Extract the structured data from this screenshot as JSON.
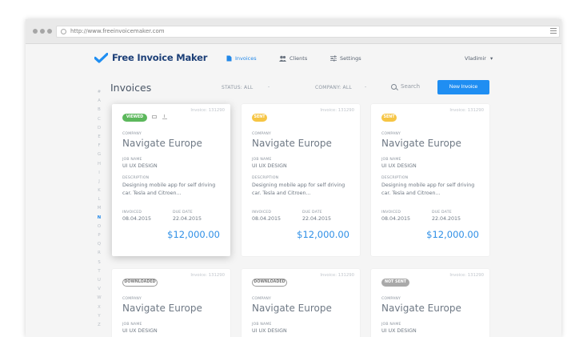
{
  "browser": {
    "url": "http://www.freeinvoicemaker.com"
  },
  "app": {
    "name": "Free Invoice Maker",
    "accent": "#1f8ef2",
    "logo_color": "#1c3f77"
  },
  "nav": {
    "items": [
      {
        "label": "Invoices",
        "icon": "document-icon",
        "active": true
      },
      {
        "label": "Clients",
        "icon": "users-icon",
        "active": false
      },
      {
        "label": "Settings",
        "icon": "sliders-icon",
        "active": false
      }
    ],
    "user": "Vladimir"
  },
  "toolbar": {
    "title": "Invoices",
    "status_filter": "STATUS: ALL",
    "company_filter": "COMPANY: ALL",
    "search_placeholder": "Search",
    "new_button": "New Invoice"
  },
  "alphabet": [
    "#",
    "A",
    "B",
    "C",
    "D",
    "E",
    "F",
    "G",
    "H",
    "I",
    "J",
    "K",
    "L",
    "M",
    "N",
    "O",
    "P",
    "Q",
    "R",
    "S",
    "T",
    "U",
    "V",
    "W",
    "X",
    "Y",
    "Z"
  ],
  "alphabet_active": "N",
  "labels": {
    "company": "COMPANY",
    "job_name": "JOB NAME",
    "description": "DESCRIPTION",
    "invoiced": "INVOICED",
    "due_date": "DUE DATE"
  },
  "cards": [
    {
      "status": "VIEWED",
      "invoice": "Invoice: 131290",
      "company": "Navigate Europe",
      "job": "UI UX DESIGN",
      "description": "Designing mobile app for self driving car. Tesla and Citroen...",
      "invoiced": "08.04.2015",
      "due": "22.04.2015",
      "amount": "$12,000.00"
    },
    {
      "status": "SENT",
      "invoice": "Invoice: 131290",
      "company": "Navigate Europe",
      "job": "UI UX DESIGN",
      "description": "Designing mobile app for self driving car. Tesla and Citroen...",
      "invoiced": "08.04.2015",
      "due": "22.04.2015",
      "amount": "$12,000.00"
    },
    {
      "status": "SENT",
      "invoice": "Invoice: 131290",
      "company": "Navigate Europe",
      "job": "UI UX DESIGN",
      "description": "Designing mobile app for self driving car. Tesla and Citroen...",
      "invoiced": "08.04.2015",
      "due": "22.04.2015",
      "amount": "$12,000.00"
    },
    {
      "status": "DOWNLOADED",
      "invoice": "Invoice: 131290",
      "company": "Navigate Europe",
      "job": "UI UX DESIGN"
    },
    {
      "status": "DOWNLOADED",
      "invoice": "Invoice: 131290",
      "company": "Navigate Europe",
      "job": "UI UX DESIGN"
    },
    {
      "status": "NOT SENT",
      "invoice": "Invoice: 131290",
      "company": "Navigate Europe",
      "job": "UI UX DESIGN"
    }
  ]
}
